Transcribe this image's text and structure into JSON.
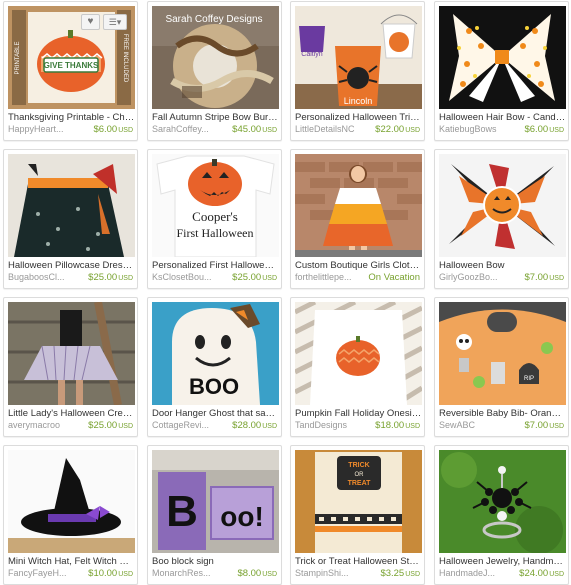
{
  "items": [
    {
      "title": "Thanksgiving Printable - Che...",
      "shop": "HappyHeart...",
      "price": "$6.00",
      "currency": "USD"
    },
    {
      "title": "Fall Autumn Stripe Bow Burla...",
      "shop": "SarahCoffey...",
      "price": "$45.00",
      "currency": "USD",
      "watermark": "Sarah Coffey Designs"
    },
    {
      "title": "Personalized Halloween Tric...",
      "shop": "LittleDetailsNC",
      "price": "$22.00",
      "currency": "USD",
      "image_text": [
        "Caitlyn",
        "Lincoln"
      ]
    },
    {
      "title": "Halloween Hair Bow - Candy...",
      "shop": "KatiebugBows",
      "price": "$6.00",
      "currency": "USD"
    },
    {
      "title": "Halloween Pillowcase Dress...",
      "shop": "BugaboosCl...",
      "price": "$25.00",
      "currency": "USD"
    },
    {
      "title": "Personalized First Halloween...",
      "shop": "KsClosetBou...",
      "price": "$25.00",
      "currency": "USD",
      "image_text": [
        "Cooper's",
        "First Halloween"
      ]
    },
    {
      "title": "Custom Boutique Girls Clothi...",
      "shop": "forthelittlepe...",
      "status": "On Vacation"
    },
    {
      "title": "Halloween Bow",
      "shop": "GirlyGoozBo...",
      "price": "$7.00",
      "currency": "USD"
    },
    {
      "title": "Little Lady's Halloween Crew...",
      "shop": "averymacroo",
      "price": "$25.00",
      "currency": "USD"
    },
    {
      "title": "Door Hanger Ghost that says...",
      "shop": "CottageRevi...",
      "price": "$28.00",
      "currency": "USD",
      "image_text": [
        "BOO"
      ]
    },
    {
      "title": "Pumpkin Fall Holiday Onesie...",
      "shop": "TandDesigns",
      "price": "$18.00",
      "currency": "USD"
    },
    {
      "title": "Reversible Baby Bib- Orange...",
      "shop": "SewABC",
      "price": "$7.00",
      "currency": "USD",
      "image_text": [
        "RIP"
      ]
    },
    {
      "title": "Mini Witch Hat, Felt Witch Ha...",
      "shop": "FancyFayeH...",
      "price": "$10.00",
      "currency": "USD"
    },
    {
      "title": "Boo block sign",
      "shop": "MonarchRes...",
      "price": "$8.00",
      "currency": "USD",
      "image_text": [
        "B",
        "oo!"
      ]
    },
    {
      "title": "Trick or Treat Halloween Sta...",
      "shop": "StampinShi...",
      "price": "$3.25",
      "currency": "USD",
      "image_text": [
        "TRICK",
        "OR",
        "TREAT"
      ]
    },
    {
      "title": "Halloween Jewelry, Handma...",
      "shop": "HandmadeJ...",
      "price": "$24.00",
      "currency": "USD"
    }
  ],
  "first_item_image_text": {
    "banner": "GIVE THANKS",
    "side_left": "PRINTABLE",
    "side_right": "FREE INCLUDED"
  },
  "overlay": {
    "favorite_icon": "heart-icon",
    "menu_icon": "list-menu-icon"
  },
  "colors": {
    "price": "#78a22f",
    "title": "#333333",
    "shop": "#999999",
    "border": "#dcdcdc"
  }
}
